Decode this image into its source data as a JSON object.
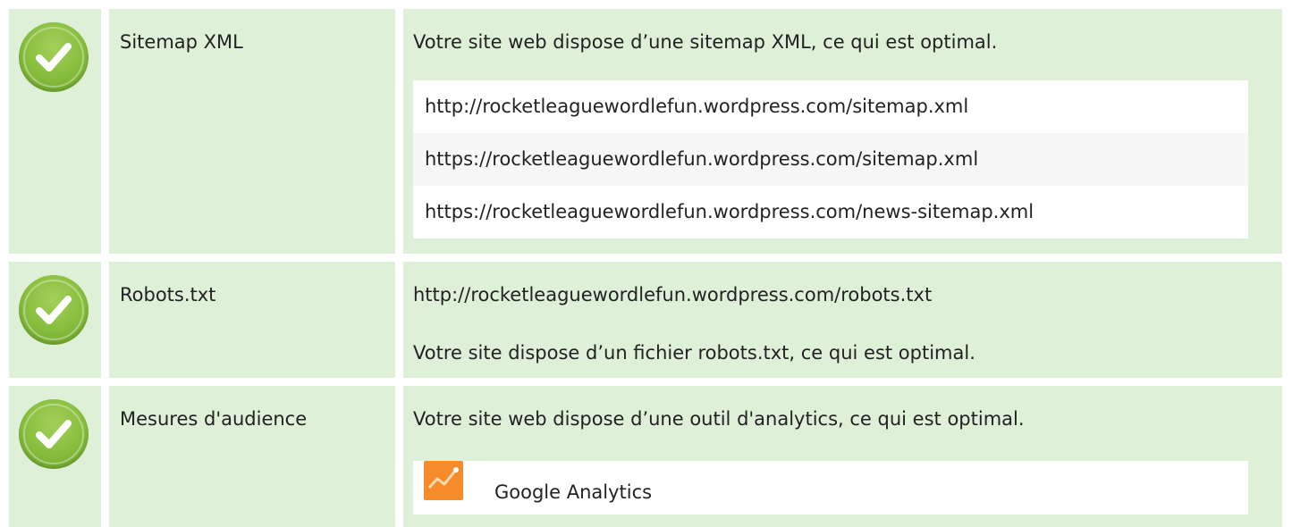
{
  "rows": [
    {
      "label": "Sitemap XML",
      "status_icon": "check-circle-icon",
      "message": "Votre site web dispose d’une sitemap XML, ce qui est optimal.",
      "urls": [
        "http://rocketleaguewordlefun.wordpress.com/sitemap.xml",
        "https://rocketleaguewordlefun.wordpress.com/sitemap.xml",
        "https://rocketleaguewordlefun.wordpress.com/news-sitemap.xml"
      ]
    },
    {
      "label": "Robots.txt",
      "status_icon": "check-circle-icon",
      "url": "http://rocketleaguewordlefun.wordpress.com/robots.txt",
      "message": "Votre site dispose d’un fichier robots.txt, ce qui est optimal."
    },
    {
      "label": "Mesures d'audience",
      "status_icon": "check-circle-icon",
      "message": "Votre site web dispose d’une outil d'analytics, ce qui est optimal.",
      "tools": [
        {
          "name": "Google Analytics",
          "icon": "google-analytics-icon"
        }
      ]
    }
  ],
  "colors": {
    "row_background": "#dff0d8",
    "check_green": "#86bd3c",
    "analytics_orange": "#f58b2a"
  }
}
